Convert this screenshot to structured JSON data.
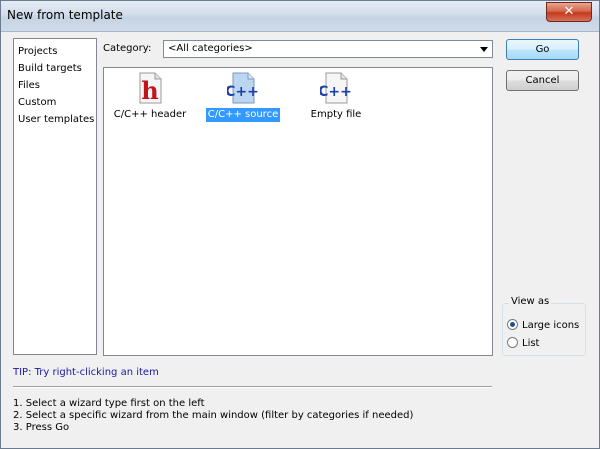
{
  "window": {
    "title": "New from template",
    "close_glyph": "✕"
  },
  "wizard_types": {
    "items": [
      {
        "label": "Projects"
      },
      {
        "label": "Build targets"
      },
      {
        "label": "Files"
      },
      {
        "label": "Custom"
      },
      {
        "label": "User templates"
      }
    ]
  },
  "category": {
    "label": "Category:",
    "value": "<All categories>"
  },
  "templates": {
    "items": [
      {
        "label": "C/C++ header",
        "icon": "c-header-file-icon",
        "glyph": "h",
        "glyph_color": "#c0141b"
      },
      {
        "label": "C/C++ source",
        "icon": "c-source-file-icon",
        "glyph": "C++",
        "glyph_color": "#1d3fa8",
        "selected": true
      },
      {
        "label": "Empty file",
        "icon": "empty-file-icon",
        "glyph": "C++",
        "glyph_color": "#1d3fa8"
      }
    ]
  },
  "buttons": {
    "go": "Go",
    "cancel": "Cancel"
  },
  "view_as": {
    "legend": "View as",
    "options": [
      {
        "label": "Large icons",
        "checked": true
      },
      {
        "label": "List",
        "checked": false
      }
    ]
  },
  "tip": "TIP: Try right-clicking an item",
  "instructions": [
    "1. Select a wizard type first on the left",
    "2. Select a specific wizard from the main window (filter by categories if needed)",
    "3. Press Go"
  ],
  "colors": {
    "selection": "#3399ff",
    "tip_text": "#1a1aa6",
    "title_gradient_top": "#e4ecf5"
  }
}
